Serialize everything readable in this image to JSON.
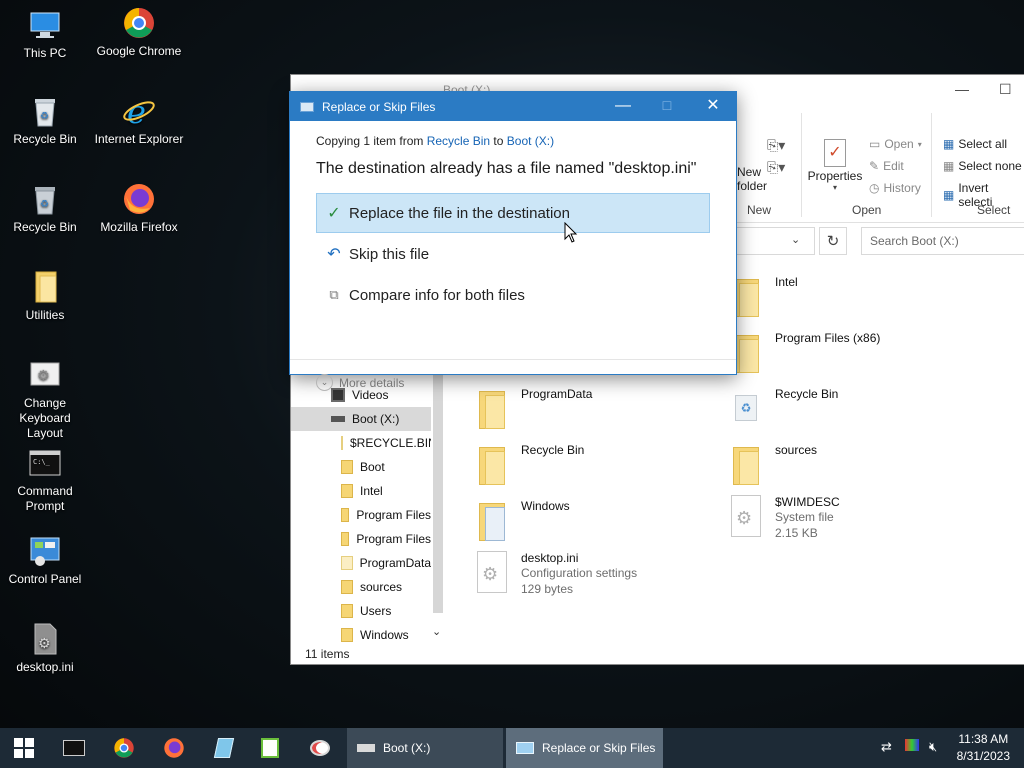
{
  "desktop": {
    "icons": [
      {
        "label": "This PC",
        "icon": "this-pc-icon"
      },
      {
        "label": "Google Chrome",
        "icon": "chrome-icon"
      },
      {
        "label": "Recycle Bin",
        "icon": "recycle-bin-icon"
      },
      {
        "label": "Internet Explorer",
        "icon": "internet-explorer-icon"
      },
      {
        "label": "Recycle Bin",
        "icon": "recycle-bin-icon"
      },
      {
        "label": "Mozilla Firefox",
        "icon": "firefox-icon"
      },
      {
        "label": "Utilities",
        "icon": "folder-icon"
      },
      {
        "label": "Change\nKeyboard Layout",
        "icon": "keyboard-layout-icon"
      },
      {
        "label": "Command\nPrompt",
        "icon": "command-prompt-icon"
      },
      {
        "label": "Control Panel",
        "icon": "control-panel-icon"
      },
      {
        "label": "desktop.ini",
        "icon": "settings-file-icon"
      }
    ]
  },
  "explorer": {
    "title": "Boot (X:)",
    "ribbon": {
      "new_folder_label": "New\nfolder",
      "new_group": "New",
      "properties_label": "Properties",
      "open_label": "Open",
      "edit_label": "Edit",
      "history_label": "History",
      "open_group": "Open",
      "select_all": "Select all",
      "select_none": "Select none",
      "invert_selection": "Invert selecti",
      "select_group": "Select"
    },
    "search_placeholder": "Search Boot (X:)",
    "nav": [
      {
        "label": "Videos",
        "icon": "videos-icon"
      },
      {
        "label": "Boot (X:)",
        "icon": "drive-icon",
        "selected": true
      },
      {
        "label": "$RECYCLE.BIN",
        "icon": "folder-icon"
      },
      {
        "label": "Boot",
        "icon": "folder-icon"
      },
      {
        "label": "Intel",
        "icon": "folder-icon"
      },
      {
        "label": "Program Files",
        "icon": "folder-icon"
      },
      {
        "label": "Program Files",
        "icon": "folder-icon"
      },
      {
        "label": "ProgramData",
        "icon": "folder-icon"
      },
      {
        "label": "sources",
        "icon": "folder-icon"
      },
      {
        "label": "Users",
        "icon": "folder-icon"
      },
      {
        "label": "Windows",
        "icon": "folder-icon"
      }
    ],
    "files_col1": [
      {
        "name": "ProgramData",
        "icon": "folder-icon"
      },
      {
        "name": "Recycle Bin",
        "icon": "folder-icon"
      },
      {
        "name": "Windows",
        "icon": "folder-icon"
      },
      {
        "name": "desktop.ini",
        "type": "Configuration settings",
        "size": "129 bytes",
        "icon": "settings-file-icon"
      }
    ],
    "files_col2": [
      {
        "name": "Intel",
        "icon": "folder-icon"
      },
      {
        "name": "Program Files (x86)",
        "icon": "folder-icon"
      },
      {
        "name": "Recycle Bin",
        "icon": "recycle-bin-icon"
      },
      {
        "name": "sources",
        "icon": "folder-icon"
      },
      {
        "name": "$WIMDESC",
        "type": "System file",
        "size": "2.15 KB",
        "icon": "system-file-icon"
      }
    ],
    "status": "11 items"
  },
  "dialog": {
    "title": "Replace or Skip Files",
    "copy_prefix": "Copying 1 item from ",
    "source": "Recycle Bin",
    "to": " to ",
    "destination": "Boot (X:)",
    "headline": "The destination already has a file named \"desktop.ini\"",
    "options": [
      {
        "label": "Replace the file in the destination",
        "icon": "checkmark-icon",
        "selected": true
      },
      {
        "label": "Skip this file",
        "icon": "skip-arrow-icon"
      },
      {
        "label": "Compare info for both files",
        "icon": "compare-icon"
      }
    ],
    "more_details": "More details"
  },
  "taskbar": {
    "windows": [
      {
        "label": "Boot (X:)",
        "icon": "drive-icon"
      },
      {
        "label": "Replace or Skip Files",
        "icon": "dialog-icon",
        "active": true
      }
    ],
    "time": "11:38 AM",
    "date": "8/31/2023"
  }
}
